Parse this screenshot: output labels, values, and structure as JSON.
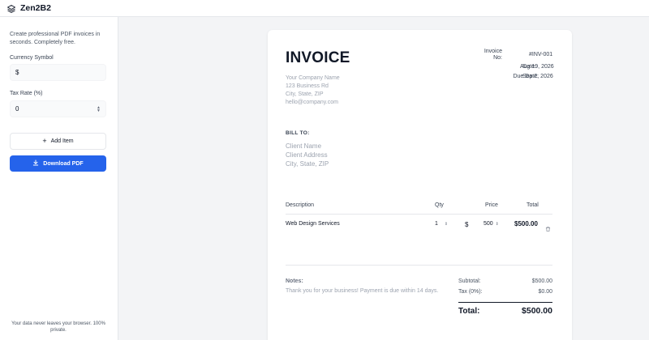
{
  "app": {
    "title": "Zen2B2"
  },
  "sidebar": {
    "tagline": "Create professional PDF invoices in seconds. Completely free.",
    "currency_label": "Currency Symbol",
    "currency_value": "$",
    "tax_label": "Tax Rate (%)",
    "tax_value": "0",
    "add_item_label": "Add Item",
    "download_label": "Download PDF",
    "privacy_note": "Your data never leaves your browser. 100% private."
  },
  "invoice": {
    "heading": "INVOICE",
    "company": [
      "Your Company Name",
      "123 Business Rd",
      "City, State, ZIP",
      "hello@company.com"
    ],
    "meta": {
      "invoice_no_label_1": "Invoice",
      "invoice_no_label_2": "No:",
      "invoice_no": "#INV-001",
      "date_label": "Date:",
      "date": "Aug 19, 2026",
      "due_label": "Due Date:",
      "due_date": "Sep 2, 2026"
    },
    "bill_to": {
      "label": "BILL TO:",
      "lines": [
        "Client Name",
        "Client Address",
        "City, State, ZIP"
      ]
    },
    "table": {
      "headers": {
        "description": "Description",
        "qty": "Qty",
        "price": "Price",
        "total": "Total"
      },
      "rows": [
        {
          "description": "Web Design Services",
          "qty": "1",
          "currency": "$",
          "price": "500",
          "total": "$500.00"
        }
      ]
    },
    "notes": {
      "label": "Notes:",
      "text": "Thank you for your business! Payment is due within 14 days."
    },
    "summary": {
      "subtotal_label": "Subtotal:",
      "subtotal": "$500.00",
      "tax_label": "Tax (0%):",
      "tax": "$0.00",
      "total_label": "Total:",
      "total": "$500.00"
    }
  },
  "colors": {
    "accent": "#2563eb",
    "page_bg": "#f3f4f6",
    "card_bg": "#ffffff"
  }
}
